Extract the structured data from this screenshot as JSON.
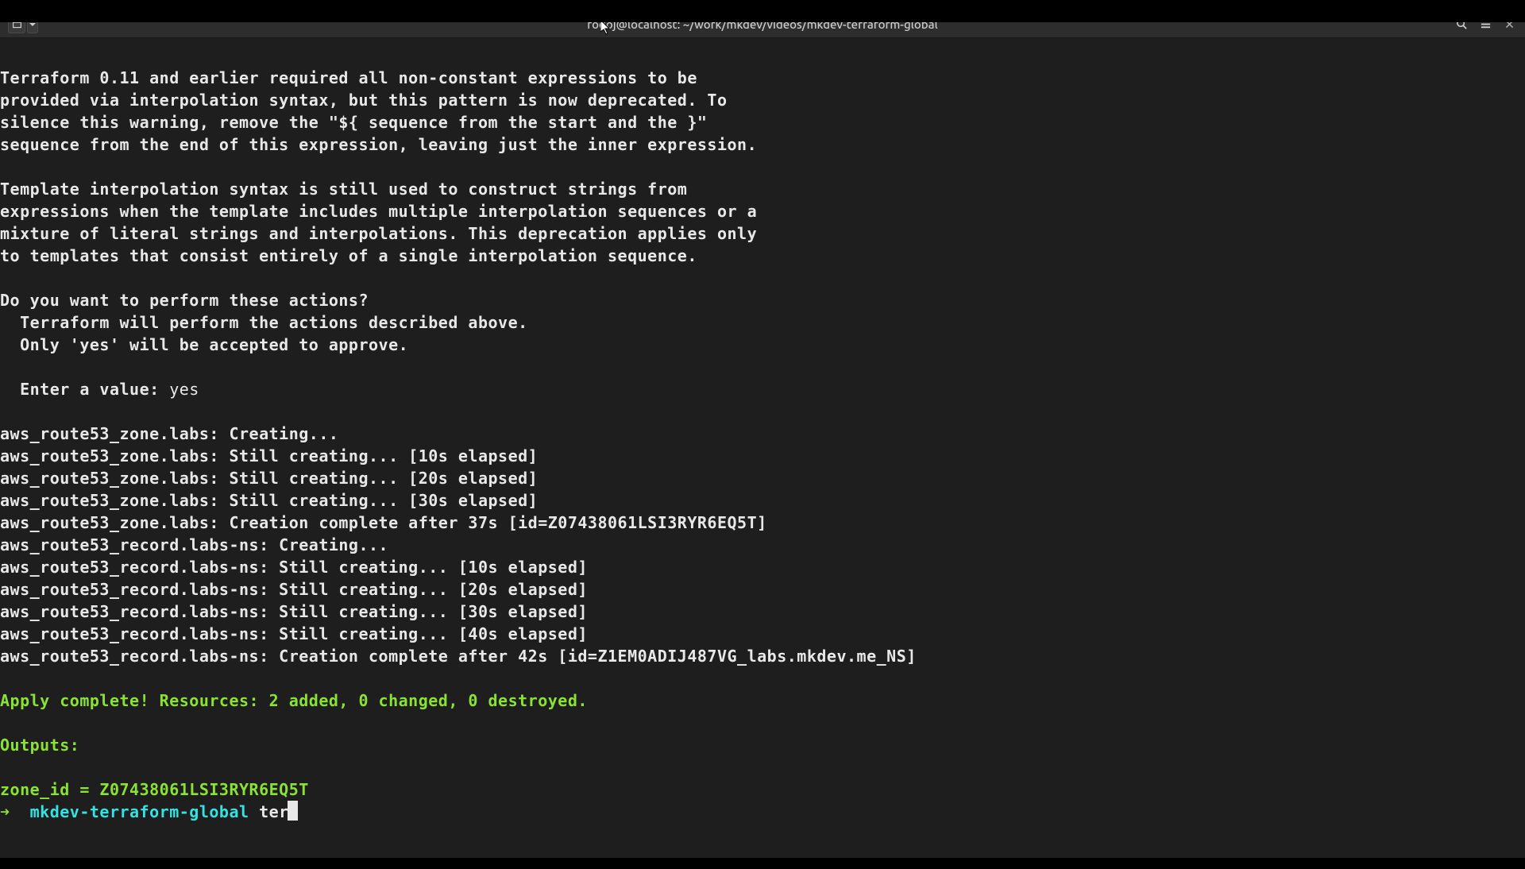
{
  "window": {
    "title": "fodoj@localhost: ~/work/mkdev/videos/mkdev-terraform-global"
  },
  "terminal": {
    "lines": [
      {
        "class": "text-white",
        "text": "Terraform 0.11 and earlier required all non-constant expressions to be"
      },
      {
        "class": "text-white",
        "text": "provided via interpolation syntax, but this pattern is now deprecated. To"
      },
      {
        "class": "text-white",
        "text": "silence this warning, remove the \"${ sequence from the start and the }\""
      },
      {
        "class": "text-white",
        "text": "sequence from the end of this expression, leaving just the inner expression."
      },
      {
        "class": "blank",
        "text": ""
      },
      {
        "class": "text-white",
        "text": "Template interpolation syntax is still used to construct strings from"
      },
      {
        "class": "text-white",
        "text": "expressions when the template includes multiple interpolation sequences or a"
      },
      {
        "class": "text-white",
        "text": "mixture of literal strings and interpolations. This deprecation applies only"
      },
      {
        "class": "text-white",
        "text": "to templates that consist entirely of a single interpolation sequence."
      },
      {
        "class": "blank",
        "text": ""
      }
    ],
    "confirm_prompt": "Do you want to perform these actions?",
    "confirm_line1": "  Terraform will perform the actions described above.",
    "confirm_line2": "  Only 'yes' will be accepted to approve.",
    "enter_label": "  Enter a value: ",
    "enter_value": "yes",
    "progress": [
      "aws_route53_zone.labs: Creating...",
      "aws_route53_zone.labs: Still creating... [10s elapsed]",
      "aws_route53_zone.labs: Still creating... [20s elapsed]",
      "aws_route53_zone.labs: Still creating... [30s elapsed]",
      "aws_route53_zone.labs: Creation complete after 37s [id=Z07438061LSI3RYR6EQ5T]",
      "aws_route53_record.labs-ns: Creating...",
      "aws_route53_record.labs-ns: Still creating... [10s elapsed]",
      "aws_route53_record.labs-ns: Still creating... [20s elapsed]",
      "aws_route53_record.labs-ns: Still creating... [30s elapsed]",
      "aws_route53_record.labs-ns: Still creating... [40s elapsed]",
      "aws_route53_record.labs-ns: Creation complete after 42s [id=Z1EM0ADIJ487VG_labs.mkdev.me_NS]"
    ],
    "apply_complete": "Apply complete! Resources: 2 added, 0 changed, 0 destroyed.",
    "outputs_label": "Outputs:",
    "output_zone": "zone_id = Z07438061LSI3RYR6EQ5T",
    "prompt_arrow": "➜  ",
    "prompt_dir": "mkdev-terraform-global ",
    "prompt_input": "ter"
  }
}
